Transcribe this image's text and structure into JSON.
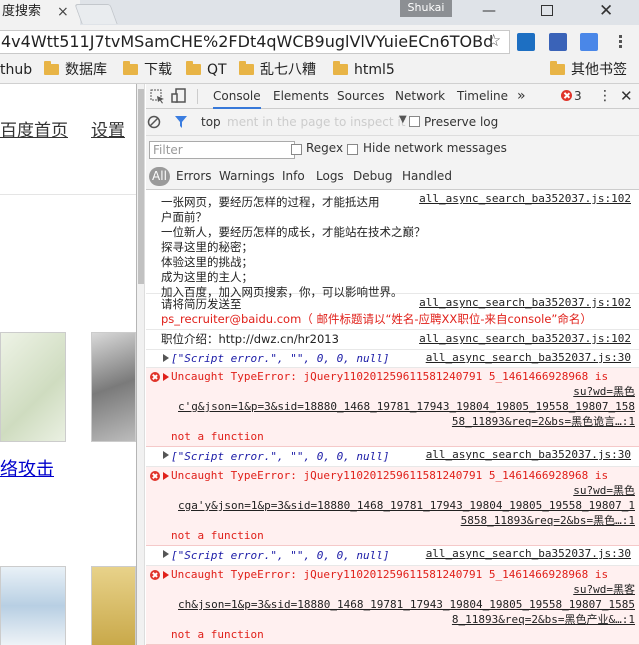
{
  "browser": {
    "tab_title": "度搜索",
    "tab_close": "×",
    "profile_name": "Shukai",
    "url": "4v4Wtt511J7tvMSamCHE%2FDt4qWCB9uglVlVYuieECn6TOBd",
    "bookmarks": [
      {
        "label": "thub",
        "folder": false
      },
      {
        "label": "数据库",
        "folder": true
      },
      {
        "label": "下载",
        "folder": true
      },
      {
        "label": "QT",
        "folder": true
      },
      {
        "label": "乱七八糟",
        "folder": true
      },
      {
        "label": "html5",
        "folder": true
      },
      {
        "label": "其他书签",
        "folder": true
      }
    ]
  },
  "page": {
    "link_home": "百度首页",
    "link_settings": "设置",
    "link_attack": "络攻击"
  },
  "devtools": {
    "tabs": [
      "Console",
      "Elements",
      "Sources",
      "Network",
      "Timeline"
    ],
    "more": "»",
    "error_count": "3",
    "context": "top",
    "context_hint": "ment in the page to inspect it",
    "preserve_log": "Preserve log",
    "filter_placeholder": "Filter",
    "regex": "Regex",
    "hide_network": "Hide network messages",
    "levels": [
      "All",
      "Errors",
      "Warnings",
      "Info",
      "Logs",
      "Debug",
      "Handled"
    ]
  },
  "console": {
    "msg1": {
      "lines": [
        "一张网页，要经历怎样的过程，才能抵达用",
        "户面前？",
        "一位新人，要经历怎样的成长，才能站在技术之巅？",
        "探寻这里的秘密；",
        "体验这里的挑战；",
        "成为这里的主人；",
        "加入百度，加入网页搜索，你，可以影响世界。"
      ],
      "source": "all_async_search_ba352037.js:102"
    },
    "msg2": {
      "line1": "请将简历发送至",
      "line2a": "ps_recruiter@baidu.com",
      "line2b": "（ 邮件标题请以“姓名-应聘XX职位-来自console”命名）",
      "source": "all_async_search_ba352037.js:102"
    },
    "msg3": {
      "text": "职位介绍：http://dwz.cn/hr2013",
      "source": "all_async_search_ba352037.js:102"
    },
    "array_log": {
      "text": "[\"Script error.\", \"\", 0, 0, null]",
      "source": "all_async_search_ba352037.js:30"
    },
    "errors": [
      {
        "head": "Uncaught TypeError: jQuery110201259611581240791 5_1461466928968 is",
        "right1": "su?wd=黑色",
        "lines": [
          "c'g&json=1&p=3&sid=18880_1468_19781_17943_19804_19805_19558_19807_158",
          "58_11893&req=2&bs=黑色诡言…:1"
        ],
        "tail": "not a function"
      },
      {
        "head": "Uncaught TypeError: jQuery110201259611581240791 5_1461466928968 is",
        "right1": "su?wd=黑色",
        "lines": [
          "cga'y&json=1&p=3&sid=18880_1468_19781_17943_19804_19805_19558_19807_1",
          "5858_11893&req=2&bs=黑色…:1"
        ],
        "tail": "not a function"
      },
      {
        "head": "Uncaught TypeError: jQuery110201259611581240791 5_1461466928968 is",
        "right1": "su?wd=黑客",
        "lines": [
          "ch&json=1&p=3&sid=18880_1468_19781_17943_19804_19805_19558_19807_1585",
          "8_11893&req=2&bs=黑色产业&…:1"
        ],
        "tail": "not a function"
      }
    ]
  }
}
